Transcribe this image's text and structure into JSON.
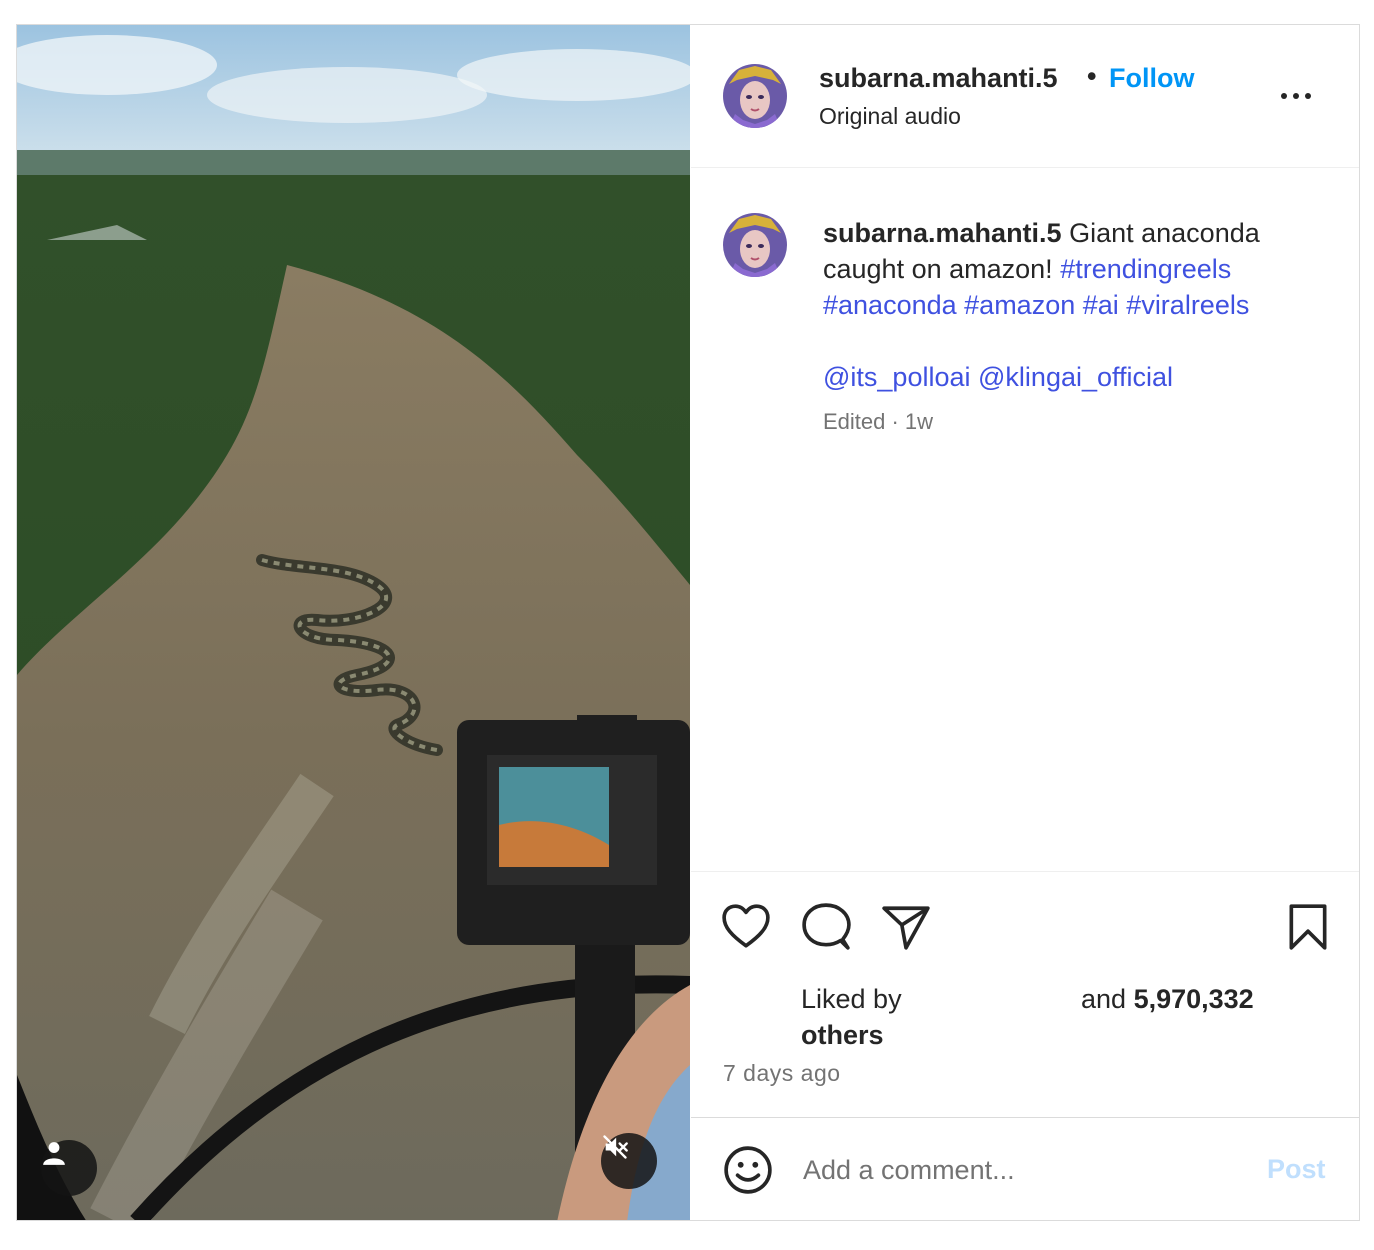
{
  "post": {
    "username": "subarna.mahanti.5",
    "separator": "•",
    "follow_label": "Follow",
    "audio": "Original audio",
    "caption": {
      "username": "subarna.mahanti.5",
      "text": "Giant anaconda caught on amazon!",
      "hashtags": [
        "#trendingreels",
        "#anaconda",
        "#amazon",
        "#ai",
        "#viralreels"
      ],
      "mentions": [
        "@its_polloai",
        "@klingai_official"
      ],
      "meta": "Edited · 1w"
    },
    "likes": {
      "prefix": "Liked by",
      "middle": "and",
      "count": "5,970,332",
      "suffix": "others"
    },
    "time_ago": "7 days ago",
    "comment": {
      "placeholder": "Add a comment...",
      "post_label": "Post"
    }
  },
  "icons": {
    "more": "more-options-icon",
    "like": "heart-icon",
    "comment": "comment-bubble-icon",
    "share": "paper-plane-icon",
    "save": "bookmark-icon",
    "emoji": "smiley-icon",
    "user": "user-icon",
    "mute": "speaker-muted-icon"
  },
  "colors": {
    "link": "#0095f6",
    "hashtag": "#3f51e0",
    "muted_text": "#737373",
    "post_disabled": "#c0dffd"
  }
}
